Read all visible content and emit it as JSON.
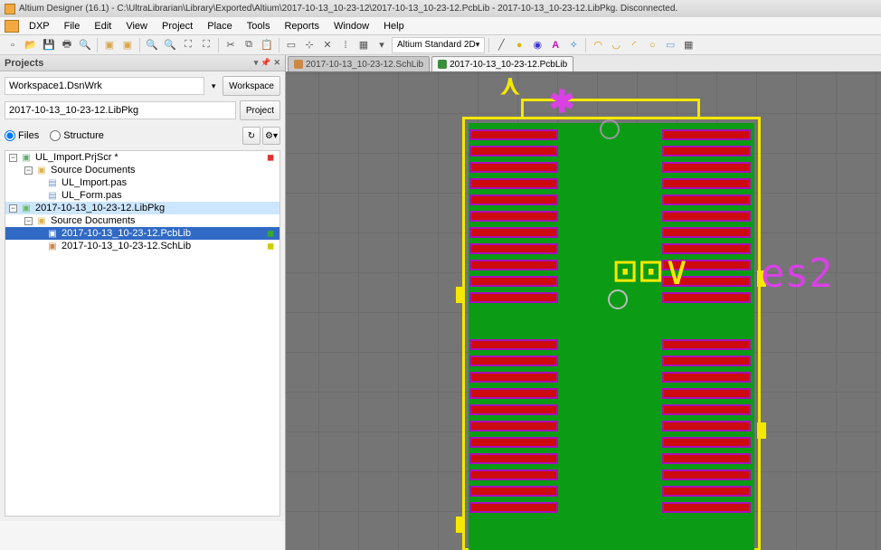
{
  "title": "Altium Designer (16.1) - C:\\UltraLibrarian\\Library\\Exported\\Altium\\2017-10-13_10-23-12\\2017-10-13_10-23-12.PcbLib - 2017-10-13_10-23-12.LibPkg. Disconnected.",
  "menu": {
    "dxp": "DXP",
    "file": "File",
    "edit": "Edit",
    "view": "View",
    "project": "Project",
    "place": "Place",
    "tools": "Tools",
    "reports": "Reports",
    "window": "Window",
    "help": "Help"
  },
  "toolbar": {
    "view_combo": "Altium Standard 2D"
  },
  "panel": {
    "title": "Projects",
    "workspace_value": "Workspace1.DsnWrk",
    "workspace_btn": "Workspace",
    "project_value": "2017-10-13_10-23-12.LibPkg",
    "project_btn": "Project",
    "files_label": "Files",
    "structure_label": "Structure"
  },
  "tree": {
    "n0": "UL_Import.PrjScr *",
    "n1": "Source Documents",
    "n2": "UL_Import.pas",
    "n3": "UL_Form.pas",
    "n4": "2017-10-13_10-23-12.LibPkg",
    "n5": "Source Documents",
    "n6": "2017-10-13_10-23-12.PcbLib",
    "n7": "2017-10-13_10-23-12.SchLib"
  },
  "tabs": {
    "t0": "2017-10-13_10-23-12.SchLib",
    "t1": "2017-10-13_10-23-12.PcbLib"
  },
  "canvas": {
    "silk_text": "⊡⊡∨",
    "overlay_text": "es2",
    "pad_rows_per_side": 22
  }
}
